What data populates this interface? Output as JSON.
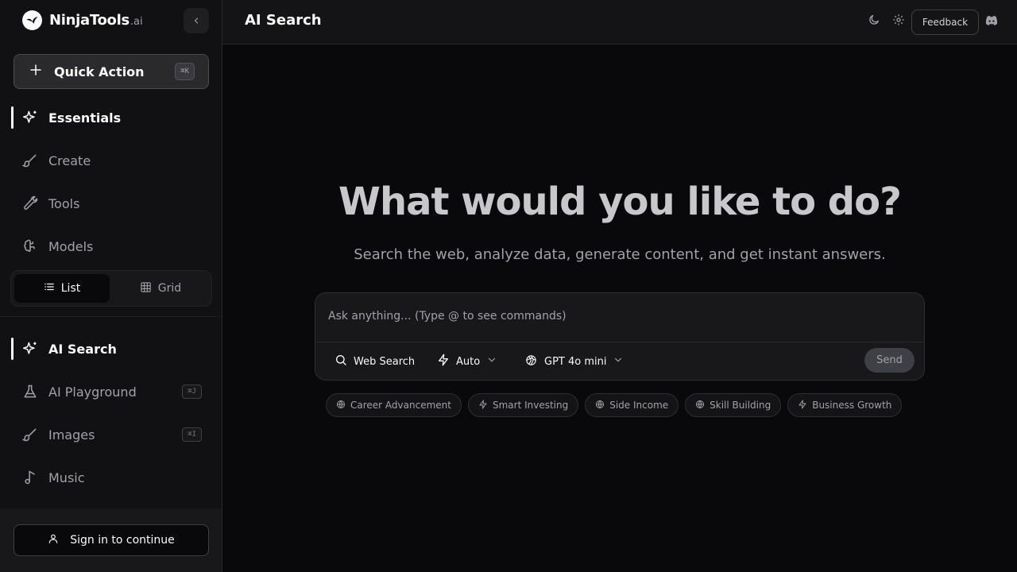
{
  "brand": {
    "name": "NinjaTools",
    "suffix": ".ai"
  },
  "quick_action": {
    "label": "Quick Action",
    "shortcut": "⌘K"
  },
  "nav_primary": [
    {
      "label": "Essentials",
      "icon": "sparkles-icon",
      "active": true
    },
    {
      "label": "Create",
      "icon": "brush-icon",
      "active": false
    },
    {
      "label": "Tools",
      "icon": "wrench-icon",
      "active": false
    },
    {
      "label": "Models",
      "icon": "brain-icon",
      "active": false
    }
  ],
  "view_toggle": {
    "list_label": "List",
    "grid_label": "Grid",
    "selected": "List"
  },
  "nav_secondary": [
    {
      "label": "AI Search",
      "icon": "sparkles-icon",
      "active": true,
      "shortcut": ""
    },
    {
      "label": "AI Playground",
      "icon": "flask-icon",
      "active": false,
      "shortcut": "⌘J"
    },
    {
      "label": "Images",
      "icon": "brush-icon",
      "active": false,
      "shortcut": "⌘I"
    },
    {
      "label": "Music",
      "icon": "music-note-icon",
      "active": false,
      "shortcut": ""
    }
  ],
  "signin": {
    "label": "Sign in to continue"
  },
  "header": {
    "title": "AI Search",
    "feedback_label": "Feedback"
  },
  "hero": {
    "title": "What would you like to do?",
    "subtitle": "Search the web, analyze data, generate content, and get instant answers."
  },
  "search": {
    "placeholder": "Ask anything... (Type @ to see commands)",
    "web_search_label": "Web Search",
    "mode_label": "Auto",
    "model_label": "GPT 4o mini",
    "send_label": "Send"
  },
  "suggestions": [
    {
      "label": "Career Advancement",
      "icon": "globe-icon"
    },
    {
      "label": "Smart Investing",
      "icon": "bolt-icon"
    },
    {
      "label": "Side Income",
      "icon": "globe-icon"
    },
    {
      "label": "Skill Building",
      "icon": "globe-icon"
    },
    {
      "label": "Business Growth",
      "icon": "bolt-icon"
    }
  ],
  "colors": {
    "background": "#09090b",
    "sidebar": "#111113",
    "accent": "#fafafa",
    "muted": "#a1a1aa"
  }
}
